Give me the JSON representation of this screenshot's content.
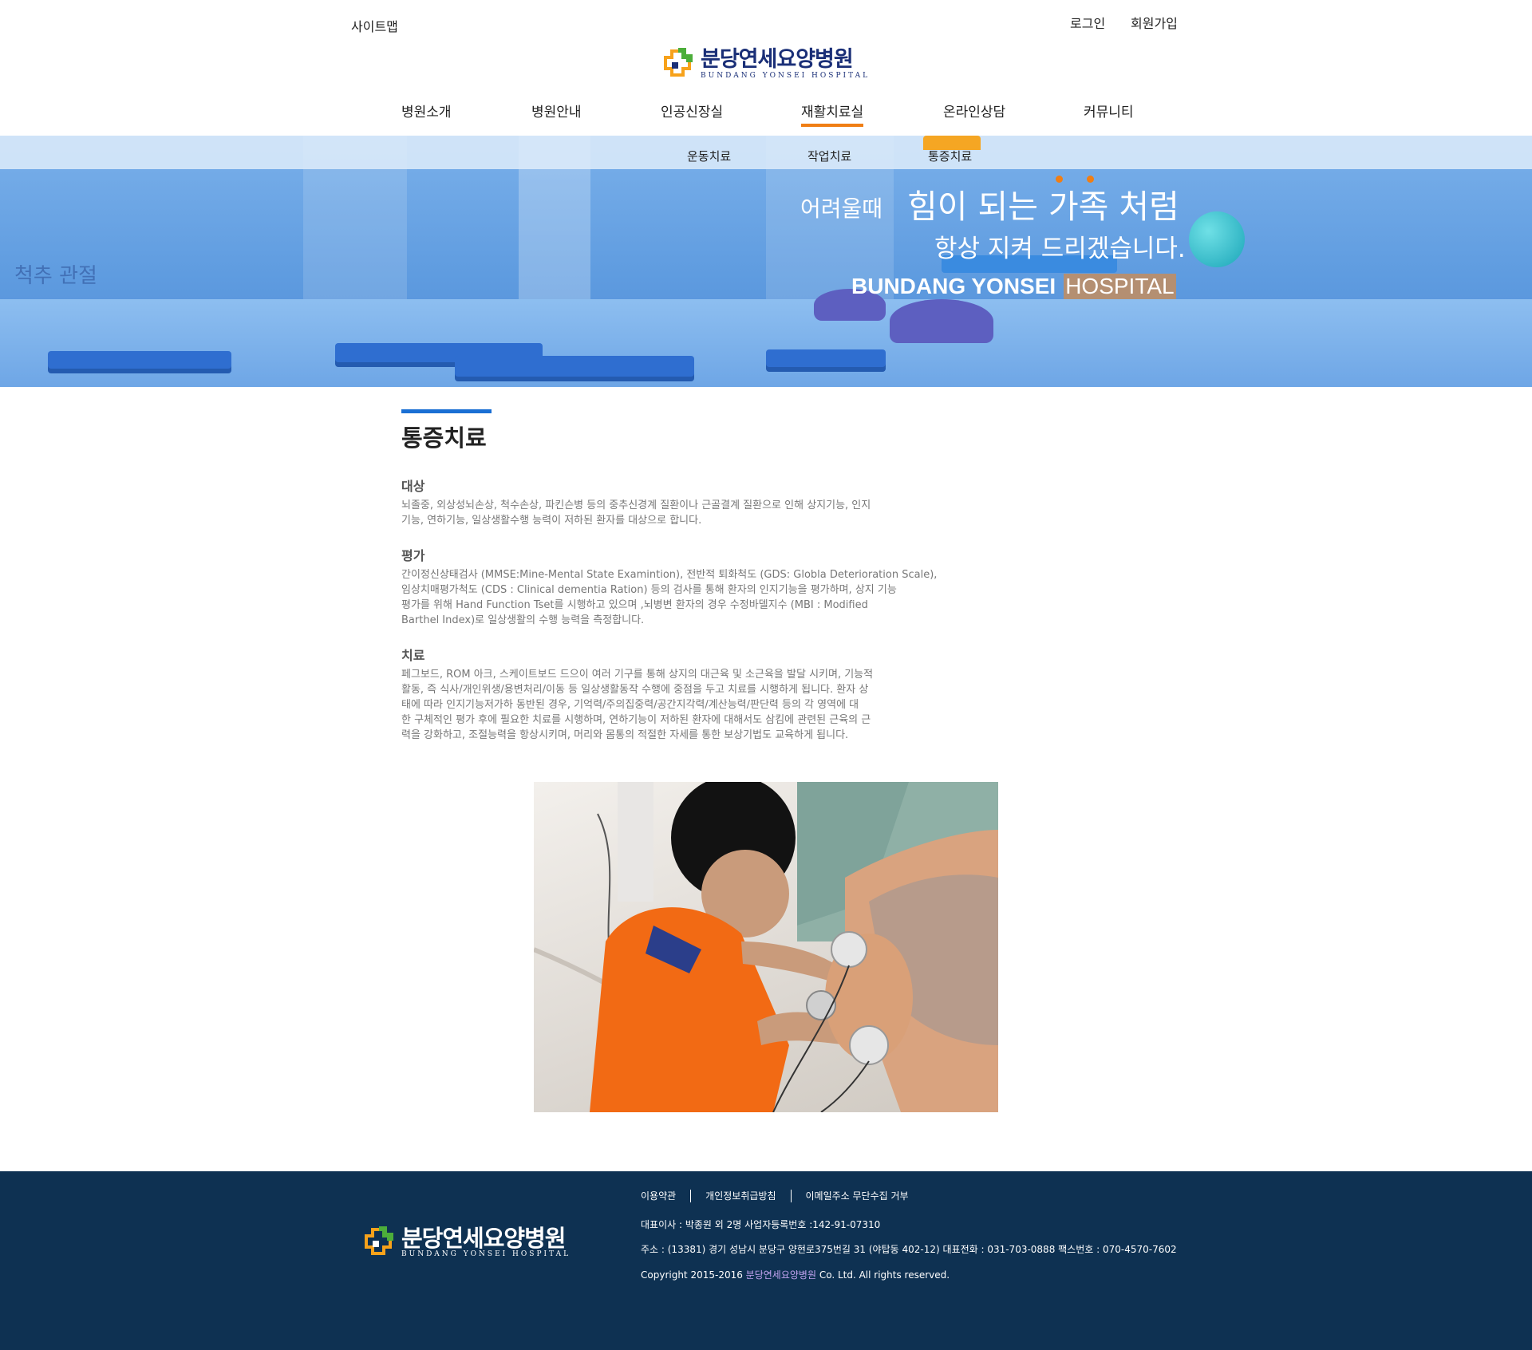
{
  "header": {
    "sitemap": "사이트맵",
    "login": "로그인",
    "join": "회원가입",
    "logo_ko": "분당연세요양병원",
    "logo_en": "BUNDANG YONSEI HOSPITAL"
  },
  "nav": {
    "items": [
      {
        "label": "병원소개"
      },
      {
        "label": "병원안내"
      },
      {
        "label": "인공신장실"
      },
      {
        "label": "재활치료실"
      },
      {
        "label": "온라인상담"
      },
      {
        "label": "커뮤니티"
      }
    ],
    "active": "재활치료실",
    "sub_items": [
      {
        "label": "운동치료"
      },
      {
        "label": "작업치료"
      },
      {
        "label": "통증치료"
      }
    ],
    "sub_active": "통증치료"
  },
  "hero": {
    "line1_small": "어려울때",
    "line1_large": "힘이 되는 가족 처럼",
    "line2": "항상 지켜 드리겠습니다.",
    "en_bold": "BUNDANG YONSEI",
    "en_light": "HOSPITAL",
    "wall_text": "척추 관절"
  },
  "content": {
    "title": "통증치료",
    "sections": [
      {
        "heading": "대상",
        "lines": [
          "뇌졸중, 외상성뇌손상, 척수손상, 파킨슨병 등의 중추신경계 질환이나 근골결계 질환으로 인해 상지기능, 인지",
          "기능, 연하기능, 일상생활수행 능력이 저하된 환자를 대상으로 합니다."
        ]
      },
      {
        "heading": "평가",
        "lines": [
          "간이정신상태검사 (MMSE:Mine-Mental State Examintion), 전반적 퇴화척도 (GDS: Globla Deterioration Scale),",
          "임상치매평가척도 (CDS : Clinical dementia Ration) 등의 검사를 통해 환자의 인지기능을 평가하며, 상지 기능",
          "평가를 위해 Hand Function Tset를 시행하고 있으며 ,뇌병변 환자의 경우 수정바델지수 (MBI : Modified",
          "Barthel Index)로 일상생활의 수행 능력을 측정합니다."
        ]
      },
      {
        "heading": "치료",
        "lines": [
          "페그보드, ROM 아크, 스케이트보드 드으이 여러 기구를 통해 상지의 대근육 및 소근육을 발달 시키며, 기능적",
          "활동, 즉 식사/개인위생/용변처리/이동 등 일상생활동작 수행에 중점을 두고 치료를 시행하게 됩니다. 환자 상",
          "태에 따라 인지기능저가하 동반된 경우, 기억력/주의집중력/공간지각력/계산능력/판단력 등의 각 영역에 대",
          "한 구체적인 평가 후에 필요한 치료를 시행하며, 연하기능이 저하된 환자에 대해서도 삼킴에 관련된 근육의 근",
          "력을 강화하고, 조절능력을 항상시키며, 머리와 몸통의 적절한 자세를 통한 보상기법도 교육하게 됩니다."
        ]
      }
    ]
  },
  "footer": {
    "links": [
      "이용약관",
      "개인정보취급방침",
      "이메일주소 무단수집 거부"
    ],
    "rep": "대표이사 : 박종원 외 2명 사업자등록번호 :142-91-07310",
    "address": "주소 : (13381) 경기 성남시 분당구 양현로375번길 31 (야탑동 402-12)  대표전화 : 031-703-0888  팩스번호 : 070-4570-7602",
    "copyright_pre": "Copyright 2015-2016 ",
    "copyright_name": "분당연세요양병원",
    "copyright_post": " Co. Ltd. All rights reserved.",
    "logo_ko": "분당연세요양병원",
    "logo_en": "BUNDANG YONSEI HOSPITAL"
  },
  "colors": {
    "accent_orange": "#f07e14",
    "accent_blue": "#1a6fd4",
    "footer_bg": "#0e3152",
    "logo_navy": "#1a2f77",
    "logo_green": "#4cae3a",
    "logo_orange": "#f7a21b"
  }
}
